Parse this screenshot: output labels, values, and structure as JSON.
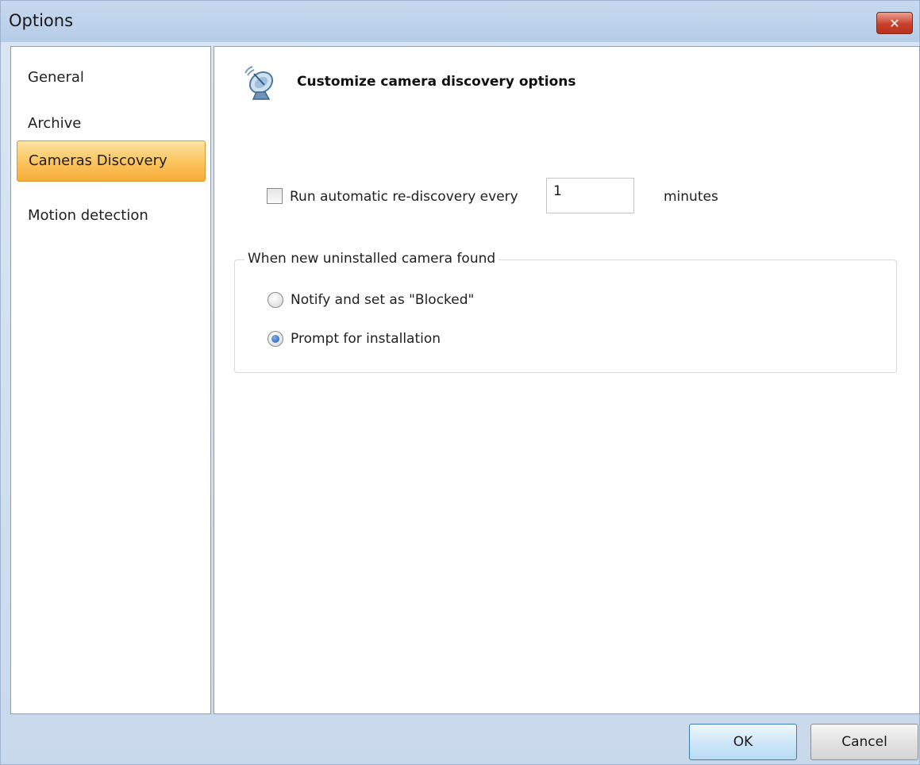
{
  "window": {
    "title": "Options",
    "close_glyph": "✕"
  },
  "sidebar": {
    "items": [
      {
        "label": "General",
        "selected": false
      },
      {
        "label": "Archive",
        "selected": false
      },
      {
        "label": "Cameras Discovery",
        "selected": true
      },
      {
        "label": "Motion detection",
        "selected": false
      }
    ]
  },
  "main": {
    "header_icon": "satellite-dish-icon",
    "title": "Customize camera discovery options",
    "auto_rediscovery": {
      "label": "Run automatic re-discovery every",
      "checked": false,
      "interval_value": "1",
      "unit": "minutes"
    },
    "group": {
      "legend": "When new uninstalled camera found",
      "options": [
        {
          "label": "Notify and set as \"Blocked\"",
          "selected": false
        },
        {
          "label": "Prompt for installation",
          "selected": true
        }
      ]
    }
  },
  "footer": {
    "ok_label": "OK",
    "cancel_label": "Cancel"
  },
  "colors": {
    "selection_orange": "#fbc661",
    "ok_button_blue": "#cfe7f7",
    "close_red": "#c9402a"
  }
}
